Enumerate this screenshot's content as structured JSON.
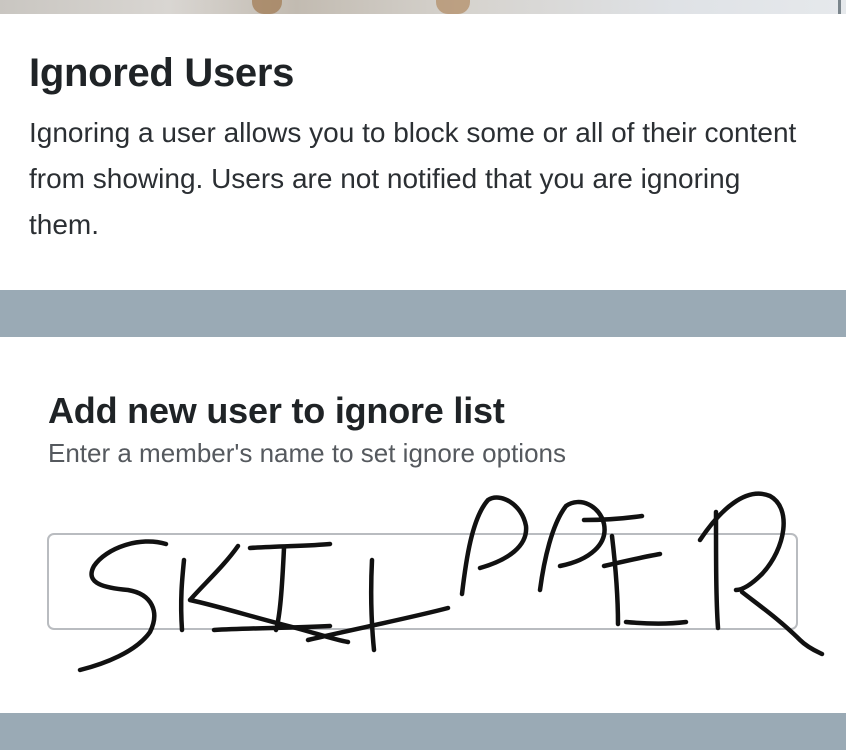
{
  "ignored_users": {
    "title": "Ignored Users",
    "description": "Ignoring a user allows you to block some or all of their content from showing. Users are not notified that you are ignoring them."
  },
  "add_user": {
    "title": "Add new user to ignore list",
    "subtitle": "Enter a member's name to set ignore options",
    "input_value": "",
    "input_placeholder": ""
  },
  "handwriting": {
    "text": "SKIPPER",
    "color": "#111111"
  },
  "colors": {
    "background": "#9aaab5",
    "card": "#ffffff",
    "heading": "#1f2326",
    "body_text": "#2b2f33",
    "muted_text": "#55595e",
    "input_border": "#b9bcc0"
  }
}
